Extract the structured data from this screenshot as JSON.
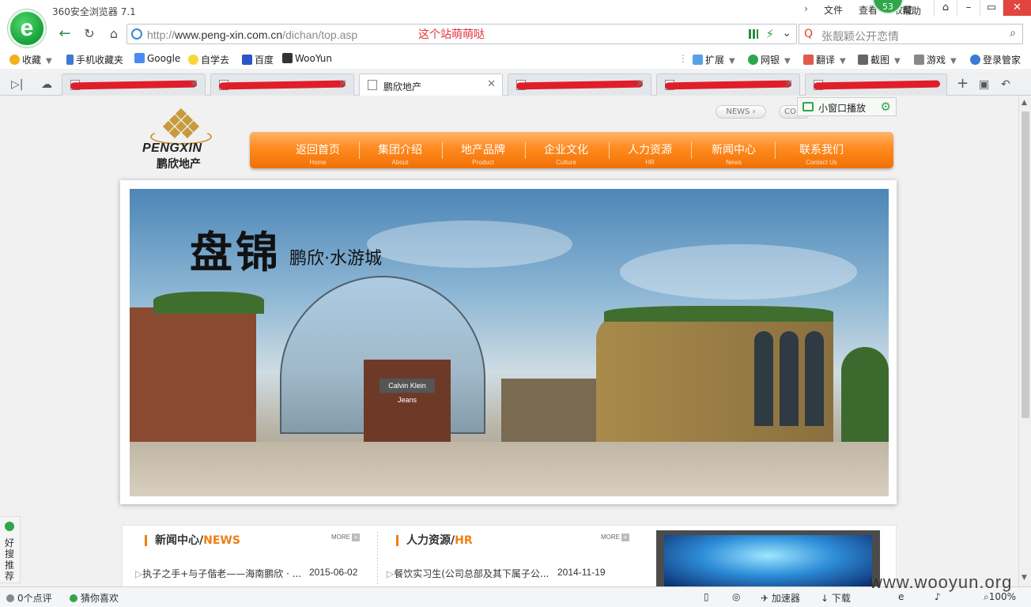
{
  "browser": {
    "app_title": "360安全浏览器 7.1",
    "menu": [
      "文件",
      "查看",
      "收藏"
    ],
    "badge_count": "53",
    "help_label": "帮助",
    "url_prefix": "http://",
    "url_domain": "www.peng-xin.com.cn",
    "url_path": "/dichan/top.asp",
    "url_annotation": "这个站萌萌哒",
    "search_placeholder": "张靓颖公开恋情",
    "bookmarks": [
      {
        "label": "收藏",
        "color": "#f2b21b"
      },
      {
        "label": "手机收藏夹",
        "color": "#3a7bd5"
      },
      {
        "label": "Google",
        "color": "#4a8af4"
      },
      {
        "label": "自学去",
        "color": "#f7d63a"
      },
      {
        "label": "百度",
        "color": "#2b55c8"
      },
      {
        "label": "WooYun",
        "color": "#333333"
      }
    ],
    "toolbar_right": [
      "扩展",
      "网银",
      "翻译",
      "截图",
      "游戏",
      "登录管家"
    ],
    "tabs": [
      {
        "label": "",
        "redacted": true,
        "active": false
      },
      {
        "label": "",
        "redacted": true,
        "active": false
      },
      {
        "label": "鹏欣地产",
        "redacted": false,
        "active": true
      },
      {
        "label": "",
        "redacted": true,
        "active": false
      },
      {
        "label": "",
        "redacted": true,
        "active": false
      },
      {
        "label": "",
        "redacted": true,
        "active": false
      }
    ],
    "popout_label": "小窗口播放"
  },
  "site": {
    "brand_en": "PENGXIN",
    "brand_cn": "鹏欣地产",
    "news_btn": "NEWS",
    "co_btn": "CO",
    "nav": [
      {
        "cn": "返回首页",
        "en": "Home"
      },
      {
        "cn": "集团介绍",
        "en": "About"
      },
      {
        "cn": "地产品牌",
        "en": "Product"
      },
      {
        "cn": "企业文化",
        "en": "Culture"
      },
      {
        "cn": "人力资源",
        "en": "HR"
      },
      {
        "cn": "新闻中心",
        "en": "News"
      },
      {
        "cn": "联系我们",
        "en": "Contact Us"
      }
    ],
    "banner_title": "盘锦",
    "banner_subtitle": "鹏欣·水游城",
    "news": {
      "title_cn": "新闻中心/",
      "title_en": "NEWS",
      "more": "MORE",
      "item_text": "执子之手+与子偕老——海南鹏欣 · ...",
      "item_date": "2015-06-02"
    },
    "hr": {
      "title_cn": "人力资源/",
      "title_en": "HR",
      "more": "MORE",
      "item_text": "餐饮实习生(公司总部及其下属子公...",
      "item_date": "2014-11-19"
    },
    "side_widget": "好搜推荐"
  },
  "statusbar": {
    "comments": "0个点评",
    "guess": "猜你喜欢",
    "accelerator": "加速器",
    "download": "下载",
    "zoom": "100%"
  },
  "watermark": "www.wooyun.org"
}
